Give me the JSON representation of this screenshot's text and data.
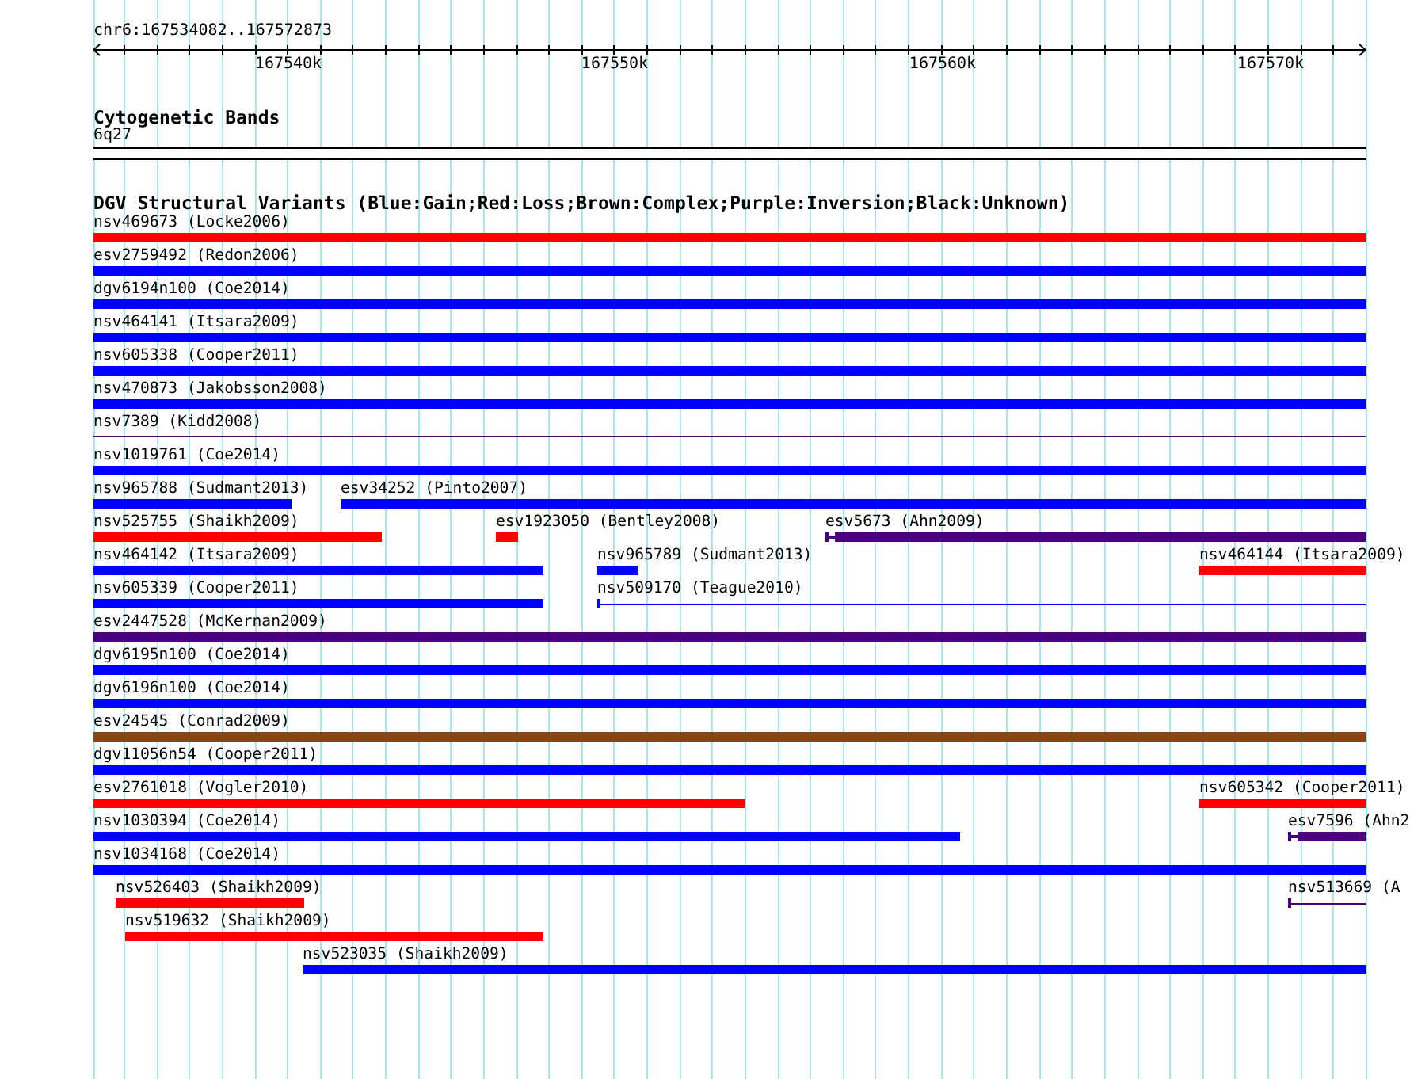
{
  "ruler": {
    "title": "chr6:167534082..167572873",
    "labels": [
      {
        "label": "167540k"
      },
      {
        "label": "167550k"
      },
      {
        "label": "167560k"
      },
      {
        "label": "167570k"
      }
    ]
  },
  "cytogenetic_bands": {
    "title": "Cytogenetic Bands",
    "band": "6q27"
  },
  "dgv_track": {
    "title": "DGV Structural Variants (Blue:Gain;Red:Loss;Brown:Complex;Purple:Inversion;Black:Unknown)",
    "rows": [
      {
        "features": [
          {
            "label": "nsv469673 (Locke2006)",
            "color": "#ff0000",
            "kind": "bar"
          }
        ]
      },
      {
        "features": [
          {
            "label": "esv2759492 (Redon2006)",
            "color": "#0000ff",
            "kind": "bar"
          }
        ]
      },
      {
        "features": [
          {
            "label": "dgv6194n100 (Coe2014)",
            "color": "#0000ff",
            "kind": "bar"
          }
        ]
      },
      {
        "features": [
          {
            "label": "nsv464141 (Itsara2009)",
            "color": "#0000ff",
            "kind": "bar"
          }
        ]
      },
      {
        "features": [
          {
            "label": "nsv605338 (Cooper2011)",
            "color": "#0000ff",
            "kind": "bar"
          }
        ]
      },
      {
        "features": [
          {
            "label": "nsv470873 (Jakobsson2008)",
            "color": "#0000ff",
            "kind": "bar"
          }
        ]
      },
      {
        "features": [
          {
            "label": "nsv7389 (Kidd2008)",
            "color": "#4b0082",
            "kind": "line"
          }
        ]
      },
      {
        "features": [
          {
            "label": "nsv1019761 (Coe2014)",
            "color": "#0000ff",
            "kind": "bar"
          }
        ]
      },
      {
        "features": [
          {
            "label": "nsv965788 (Sudmant2013)",
            "color": "#0000ff",
            "kind": "bar"
          },
          {
            "label": "esv34252 (Pinto2007)",
            "color": "#0000ff",
            "kind": "bar"
          }
        ]
      },
      {
        "features": [
          {
            "label": "nsv525755 (Shaikh2009)",
            "color": "#ff0000",
            "kind": "bar"
          },
          {
            "label": "esv1923050 (Bentley2008)",
            "color": "#ff0000",
            "kind": "bar"
          },
          {
            "label": "esv5673 (Ahn2009)",
            "color": "#4b0082",
            "kind": "capped-bar"
          }
        ]
      },
      {
        "features": [
          {
            "label": "nsv464142 (Itsara2009)",
            "color": "#0000ff",
            "kind": "bar"
          },
          {
            "label": "nsv965789 (Sudmant2013)",
            "color": "#0000ff",
            "kind": "bar"
          },
          {
            "label": "nsv464144 (Itsara2009)",
            "color": "#ff0000",
            "kind": "bar"
          }
        ]
      },
      {
        "features": [
          {
            "label": "nsv605339 (Cooper2011)",
            "color": "#0000ff",
            "kind": "bar"
          },
          {
            "label": "nsv509170 (Teague2010)",
            "color": "#0000ff",
            "kind": "capped-line"
          }
        ]
      },
      {
        "features": [
          {
            "label": "esv2447528 (McKernan2009)",
            "color": "#4b0082",
            "kind": "bar"
          }
        ]
      },
      {
        "features": [
          {
            "label": "dgv6195n100 (Coe2014)",
            "color": "#0000ff",
            "kind": "bar"
          }
        ]
      },
      {
        "features": [
          {
            "label": "dgv6196n100 (Coe2014)",
            "color": "#0000ff",
            "kind": "bar"
          }
        ]
      },
      {
        "features": [
          {
            "label": "esv24545 (Conrad2009)",
            "color": "#8b4513",
            "kind": "bar"
          }
        ]
      },
      {
        "features": [
          {
            "label": "dgv11056n54 (Cooper2011)",
            "color": "#0000ff",
            "kind": "bar"
          }
        ]
      },
      {
        "features": [
          {
            "label": "esv2761018 (Vogler2010)",
            "color": "#ff0000",
            "kind": "bar"
          },
          {
            "label": "nsv605342 (Cooper2011)",
            "color": "#ff0000",
            "kind": "bar"
          }
        ]
      },
      {
        "features": [
          {
            "label": "nsv1030394 (Coe2014)",
            "color": "#0000ff",
            "kind": "bar"
          },
          {
            "label": "esv7596 (Ahn2",
            "color": "#4b0082",
            "kind": "capped-bar"
          }
        ]
      },
      {
        "features": [
          {
            "label": "nsv1034168 (Coe2014)",
            "color": "#0000ff",
            "kind": "bar"
          }
        ]
      },
      {
        "features": [
          {
            "label": "nsv526403 (Shaikh2009)",
            "color": "#ff0000",
            "kind": "bar"
          },
          {
            "label": "nsv513669 (A",
            "color": "#4b0082",
            "kind": "capped-line"
          }
        ]
      },
      {
        "features": [
          {
            "label": "nsv519632 (Shaikh2009)",
            "color": "#ff0000",
            "kind": "bar"
          }
        ]
      },
      {
        "features": [
          {
            "label": "nsv523035 (Shaikh2009)",
            "color": "#0000ff",
            "kind": "bar"
          }
        ]
      }
    ]
  }
}
